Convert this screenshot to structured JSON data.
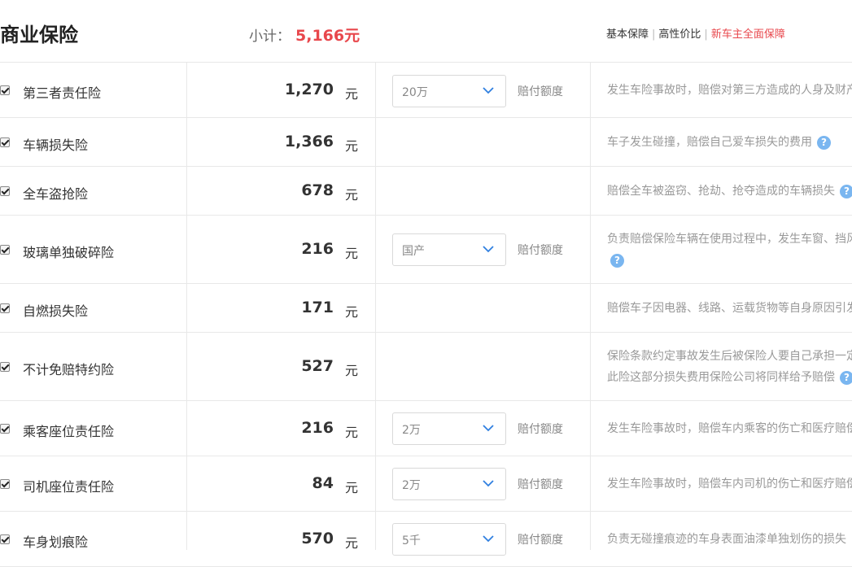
{
  "header": {
    "title": "商业保险",
    "subtotal_label": "小计：",
    "subtotal_amount": "5,166元",
    "plans": [
      "基本保障",
      "高性价比",
      "新车主全面保障"
    ]
  },
  "unit": "元",
  "pay_label": "赔付额度",
  "help_glyph": "?",
  "rows": [
    {
      "name": "第三者责任险",
      "price": "1,270",
      "select": "20万",
      "desc1": "发生车险事故时，赔偿对第三方造成的人身及财产",
      "desc2": ""
    },
    {
      "name": "车辆损失险",
      "price": "1,366",
      "select": "",
      "desc1": "车子发生碰撞，赔偿自己爱车损失的费用",
      "desc2": ""
    },
    {
      "name": "全车盗抢险",
      "price": "678",
      "select": "",
      "desc1": "赔偿全车被盗窃、抢劫、抢夺造成的车辆损失",
      "desc2": ""
    },
    {
      "name": "玻璃单独破碎险",
      "price": "216",
      "select": "国产",
      "desc1": "负责赔偿保险车辆在使用过程中，发生车窗、挡风",
      "desc2": ""
    },
    {
      "name": "自燃损失险",
      "price": "171",
      "select": "",
      "desc1": "赔偿车子因电器、线路、运载货物等自身原因引发",
      "desc2": ""
    },
    {
      "name": "不计免赔特约险",
      "price": "527",
      "select": "",
      "desc1": "保险条款约定事故发生后被保险人要自己承担一定",
      "desc2": "此险这部分损失费用保险公司将同样给予赔偿"
    },
    {
      "name": "乘客座位责任险",
      "price": "216",
      "select": "2万",
      "desc1": "发生车险事故时，赔偿车内乘客的伤亡和医疗赔偿",
      "desc2": ""
    },
    {
      "name": "司机座位责任险",
      "price": "84",
      "select": "2万",
      "desc1": "发生车险事故时，赔偿车内司机的伤亡和医疗赔偿",
      "desc2": ""
    },
    {
      "name": "车身划痕险",
      "price": "570",
      "select": "5千",
      "desc1": "负责无碰撞痕迹的车身表面油漆单独划伤的损失",
      "desc2": ""
    }
  ]
}
